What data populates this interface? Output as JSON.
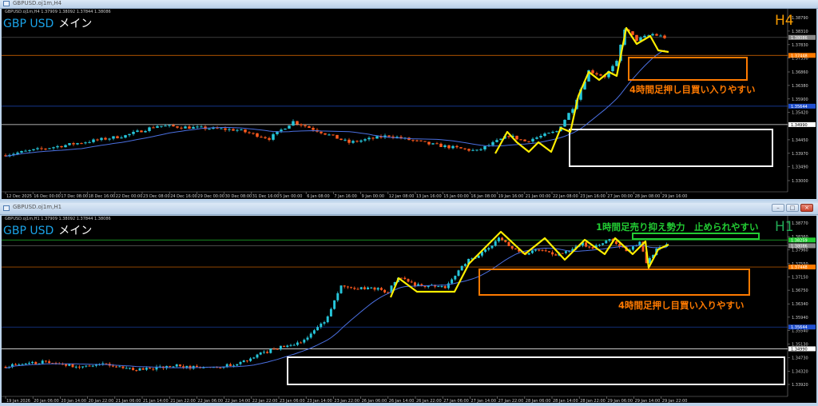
{
  "colors": {
    "bull": "#26c6da",
    "bear": "#ff5a1f",
    "ma": "#4a6fe0",
    "zigzag": "#ffee00",
    "orange": "#ff7a00",
    "white": "#ffffff",
    "green": "#22cc33",
    "blue": "#2050d0",
    "grey": "#888888"
  },
  "windows": [
    {
      "title": "GBPUSD.oj1m,H4",
      "ohlc": "GBPUSD.oj1m,H4  1.37909 1.38092 1.37844 1.38086",
      "symbol": "GBP USD",
      "symbol_suffix": "メイン",
      "timeframe": "H4",
      "note": "4時間足押し目買い入りやすい",
      "price_max": 1.3879,
      "price_min": 1.33,
      "price_ticks": [
        "1.38790",
        "1.38310",
        "1.37830",
        "1.37350",
        "1.36860",
        "1.36380",
        "1.35900",
        "1.35420",
        "1.34450",
        "1.33970",
        "1.33490",
        "1.33000"
      ],
      "levels": [
        {
          "price": 1.38086,
          "label": "1.38086",
          "kind": "grey"
        },
        {
          "price": 1.37448,
          "label": "1.37448",
          "kind": "orange"
        },
        {
          "price": 1.35644,
          "label": "1.35644",
          "kind": "blue"
        },
        {
          "price": 1.3499,
          "label": "1.34990",
          "kind": "white"
        }
      ],
      "time_labels": [
        "12 Dec 2025",
        "16 Dec 00:00",
        "17 Dec 08:00",
        "18 Dec 16:00",
        "22 Dec 00:00",
        "23 Dec 08:00",
        "24 Dec 16:00",
        "29 Dec 00:00",
        "30 Dec 08:00",
        "31 Dec 16:00",
        "5 Jan 00:00",
        "6 Jan 08:00",
        "7 Jan 16:00",
        "9 Jan 00:00",
        "12 Jan 08:00",
        "13 Jan 16:00",
        "15 Jan 00:00",
        "16 Jan 08:00",
        "19 Jan 16:00",
        "21 Jan 00:00",
        "22 Jan 08:00",
        "23 Jan 16:00",
        "27 Jan 00:00",
        "28 Jan 08:00",
        "29 Jan 16:00"
      ],
      "bars": 166,
      "price_path": [
        [
          0,
          1.339
        ],
        [
          31,
          1.346
        ],
        [
          39,
          1.3495
        ],
        [
          59,
          1.348
        ],
        [
          67,
          1.345
        ],
        [
          73,
          1.351
        ],
        [
          87,
          1.3435
        ],
        [
          97,
          1.346
        ],
        [
          107,
          1.343
        ],
        [
          119,
          1.3405
        ],
        [
          127,
          1.346
        ],
        [
          131,
          1.344
        ],
        [
          139,
          1.3475
        ],
        [
          143,
          1.356
        ],
        [
          147,
          1.369
        ],
        [
          151,
          1.367
        ],
        [
          154,
          1.372
        ],
        [
          156,
          1.384
        ],
        [
          159,
          1.38
        ],
        [
          163,
          1.382
        ],
        [
          166,
          1.3809
        ]
      ]
    },
    {
      "title": "GBPUSD.oj1m,H1",
      "ohlc": "GBPUSD.oj1m,H1  1.37909 1.38092 1.37844 1.38086",
      "symbol": "GBP USD",
      "symbol_suffix": "メイン",
      "timeframe": "H1",
      "note": "4時間足押し目買い入りやすい",
      "note2": "1時間足売り抑え勢力　止められやすい",
      "price_max": 1.3877,
      "price_min": 1.3392,
      "price_ticks": [
        "1.38770",
        "1.38360",
        "1.37960",
        "1.37550",
        "1.37150",
        "1.36750",
        "1.36340",
        "1.35940",
        "1.35540",
        "1.35130",
        "1.34730",
        "1.34320",
        "1.33920"
      ],
      "levels": [
        {
          "price": 1.38259,
          "label": "1.38259",
          "kind": "green"
        },
        {
          "price": 1.38086,
          "label": "1.38086",
          "kind": "grey"
        },
        {
          "price": 1.37448,
          "label": "1.37448",
          "kind": "orange"
        },
        {
          "price": 1.35644,
          "label": "1.35644",
          "kind": "blue"
        },
        {
          "price": 1.3499,
          "label": "1.34990",
          "kind": "white"
        }
      ],
      "time_labels": [
        "19 Jan 2026",
        "20 Jan 06:00",
        "20 Jan 14:00",
        "20 Jan 22:00",
        "21 Jan 06:00",
        "21 Jan 14:00",
        "21 Jan 22:00",
        "22 Jan 06:00",
        "22 Jan 14:00",
        "22 Jan 22:00",
        "23 Jan 06:00",
        "23 Jan 14:00",
        "23 Jan 22:00",
        "26 Jan 06:00",
        "26 Jan 14:00",
        "26 Jan 22:00",
        "27 Jan 06:00",
        "27 Jan 14:00",
        "27 Jan 22:00",
        "28 Jan 06:00",
        "28 Jan 14:00",
        "28 Jan 22:00",
        "29 Jan 06:00",
        "29 Jan 14:00",
        "29 Jan 22:00"
      ],
      "bars": 198,
      "price_path": [
        [
          0,
          1.3445
        ],
        [
          13,
          1.346
        ],
        [
          23,
          1.3445
        ],
        [
          30,
          1.3455
        ],
        [
          39,
          1.3435
        ],
        [
          51,
          1.3448
        ],
        [
          61,
          1.344
        ],
        [
          70,
          1.3455
        ],
        [
          80,
          1.3495
        ],
        [
          89,
          1.352
        ],
        [
          96,
          1.358
        ],
        [
          101,
          1.3685
        ],
        [
          111,
          1.368
        ],
        [
          115,
          1.367
        ],
        [
          118,
          1.3715
        ],
        [
          123,
          1.369
        ],
        [
          132,
          1.3685
        ],
        [
          139,
          1.377
        ],
        [
          142,
          1.378
        ],
        [
          148,
          1.383
        ],
        [
          155,
          1.3785
        ],
        [
          161,
          1.3795
        ],
        [
          165,
          1.378
        ],
        [
          173,
          1.3815
        ],
        [
          176,
          1.38
        ],
        [
          181,
          1.383
        ],
        [
          186,
          1.3795
        ],
        [
          190,
          1.382
        ],
        [
          192,
          1.3755
        ],
        [
          195,
          1.38
        ],
        [
          198,
          1.3809
        ]
      ]
    }
  ]
}
